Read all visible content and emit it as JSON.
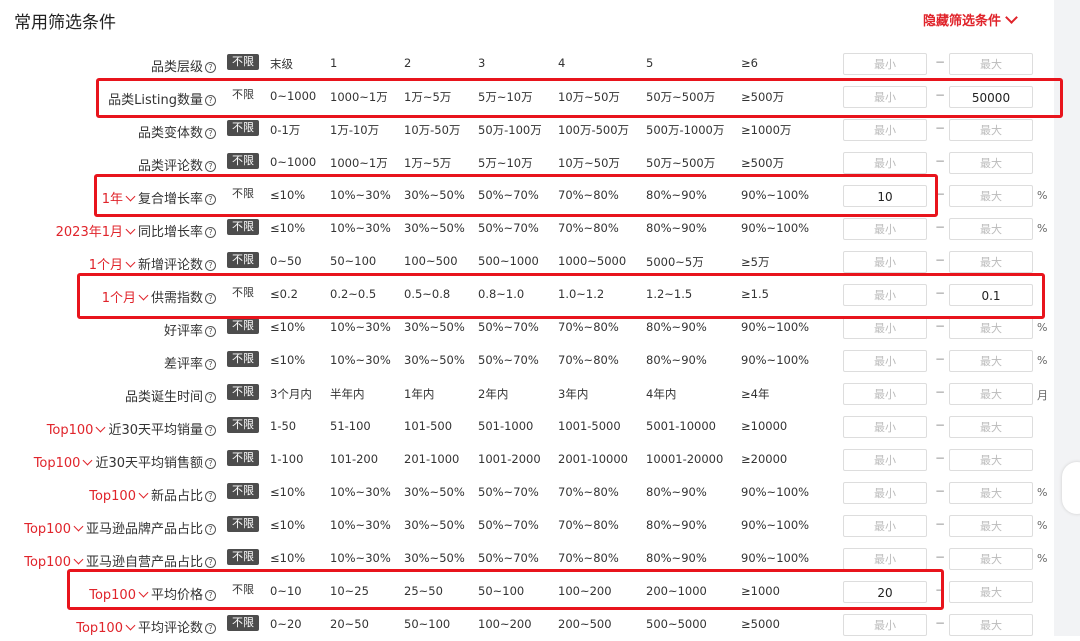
{
  "header": {
    "title": "常用筛选条件",
    "toggle_label": "隐藏筛选条件"
  },
  "no_limit": "不限",
  "min_placeholder": "最小",
  "max_placeholder": "最大",
  "dash": "−",
  "rows": [
    {
      "label": "品类层级",
      "opts": [
        "末级",
        "1",
        "2",
        "3",
        "4",
        "5",
        "≥6"
      ],
      "min": "",
      "max": "",
      "unit": "",
      "active": true
    },
    {
      "label": "品类Listing数量",
      "opts": [
        "0~1000",
        "1000~1万",
        "1万~5万",
        "5万~10万",
        "10万~50万",
        "50万~500万",
        "≥500万"
      ],
      "min": "",
      "max": "50000",
      "unit": "",
      "active": false
    },
    {
      "label": "品类变体数",
      "opts": [
        "0-1万",
        "1万-10万",
        "10万-50万",
        "50万-100万",
        "100万-500万",
        "500万-1000万",
        "≥1000万"
      ],
      "min": "",
      "max": "",
      "unit": "",
      "active": true
    },
    {
      "label": "品类评论数",
      "opts": [
        "0~1000",
        "1000~1万",
        "1万~5万",
        "5万~10万",
        "10万~50万",
        "50万~500万",
        "≥500万"
      ],
      "min": "",
      "max": "",
      "unit": "",
      "active": true
    },
    {
      "label": "复合增长率",
      "prefix": "1年",
      "opts": [
        "≤10%",
        "10%~30%",
        "30%~50%",
        "50%~70%",
        "70%~80%",
        "80%~90%",
        "90%~100%"
      ],
      "min": "10",
      "max": "",
      "unit": "%",
      "active": false
    },
    {
      "label": "同比增长率",
      "prefix": "2023年1月",
      "opts": [
        "≤10%",
        "10%~30%",
        "30%~50%",
        "50%~70%",
        "70%~80%",
        "80%~90%",
        "90%~100%"
      ],
      "min": "",
      "max": "",
      "unit": "%",
      "active": true
    },
    {
      "label": "新增评论数",
      "prefix": "1个月",
      "opts": [
        "0~50",
        "50~100",
        "100~500",
        "500~1000",
        "1000~5000",
        "5000~5万",
        "≥5万"
      ],
      "min": "",
      "max": "",
      "unit": "",
      "active": true
    },
    {
      "label": "供需指数",
      "prefix": "1个月",
      "opts": [
        "≤0.2",
        "0.2~0.5",
        "0.5~0.8",
        "0.8~1.0",
        "1.0~1.2",
        "1.2~1.5",
        "≥1.5"
      ],
      "min": "",
      "max": "0.1",
      "unit": "",
      "active": false
    },
    {
      "label": "好评率",
      "opts": [
        "≤10%",
        "10%~30%",
        "30%~50%",
        "50%~70%",
        "70%~80%",
        "80%~90%",
        "90%~100%"
      ],
      "min": "",
      "max": "",
      "unit": "%",
      "active": true
    },
    {
      "label": "差评率",
      "opts": [
        "≤10%",
        "10%~30%",
        "30%~50%",
        "50%~70%",
        "70%~80%",
        "80%~90%",
        "90%~100%"
      ],
      "min": "",
      "max": "",
      "unit": "%",
      "active": true
    },
    {
      "label": "品类诞生时间",
      "opts": [
        "3个月内",
        "半年内",
        "1年内",
        "2年内",
        "3年内",
        "4年内",
        "≥4年"
      ],
      "min": "",
      "max": "",
      "unit": "月",
      "active": true
    },
    {
      "label": "近30天平均销量",
      "prefix": "Top100",
      "opts": [
        "1-50",
        "51-100",
        "101-500",
        "501-1000",
        "1001-5000",
        "5001-10000",
        "≥10000"
      ],
      "min": "",
      "max": "",
      "unit": "",
      "active": true
    },
    {
      "label": "近30天平均销售额",
      "prefix": "Top100",
      "opts": [
        "1-100",
        "101-200",
        "201-1000",
        "1001-2000",
        "2001-10000",
        "10001-20000",
        "≥20000"
      ],
      "min": "",
      "max": "",
      "unit": "",
      "active": true
    },
    {
      "label": "新品占比",
      "prefix": "Top100",
      "opts": [
        "≤10%",
        "10%~30%",
        "30%~50%",
        "50%~70%",
        "70%~80%",
        "80%~90%",
        "90%~100%"
      ],
      "min": "",
      "max": "",
      "unit": "%",
      "active": true
    },
    {
      "label": "亚马逊品牌产品占比",
      "prefix": "Top100",
      "opts": [
        "≤10%",
        "10%~30%",
        "30%~50%",
        "50%~70%",
        "70%~80%",
        "80%~90%",
        "90%~100%"
      ],
      "min": "",
      "max": "",
      "unit": "%",
      "active": true
    },
    {
      "label": "亚马逊自营产品占比",
      "prefix": "Top100",
      "opts": [
        "≤10%",
        "10%~30%",
        "30%~50%",
        "50%~70%",
        "70%~80%",
        "80%~90%",
        "90%~100%"
      ],
      "min": "",
      "max": "",
      "unit": "%",
      "active": true
    },
    {
      "label": "平均价格",
      "prefix": "Top100",
      "opts": [
        "0~10",
        "10~25",
        "25~50",
        "50~100",
        "100~200",
        "200~1000",
        "≥1000"
      ],
      "min": "20",
      "max": "",
      "unit": "",
      "active": false
    },
    {
      "label": "平均评论数",
      "prefix": "Top100",
      "opts": [
        "0~20",
        "20~50",
        "50~100",
        "100~200",
        "200~500",
        "500~5000",
        "≥5000"
      ],
      "min": "",
      "max": "",
      "unit": "",
      "active": true
    }
  ]
}
